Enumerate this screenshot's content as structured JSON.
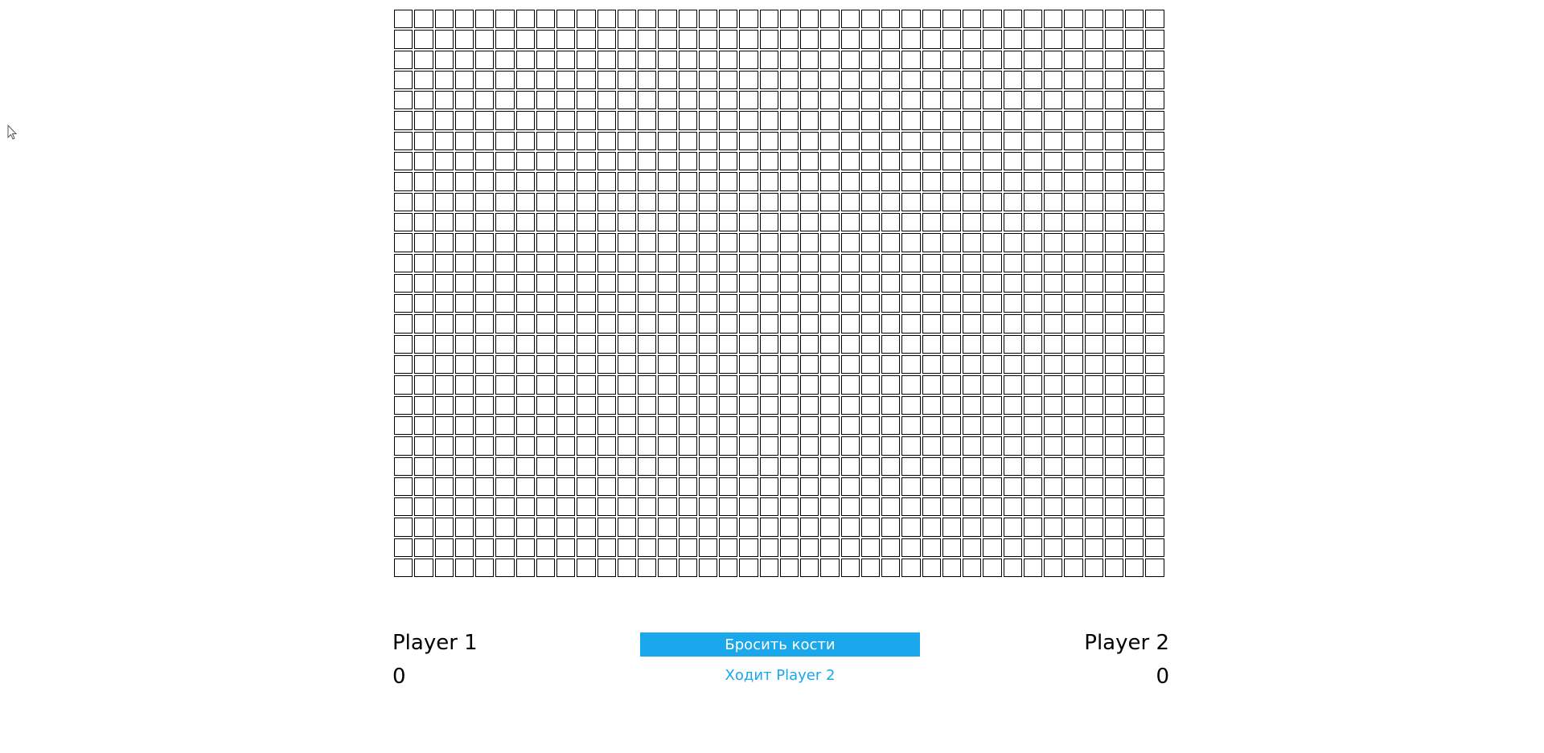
{
  "board": {
    "columns": 38,
    "rows": 28
  },
  "players": [
    {
      "name": "Player 1",
      "score": "0"
    },
    {
      "name": "Player 2",
      "score": "0"
    }
  ],
  "controls": {
    "roll_label": "Бросить кости",
    "turn_status": "Ходит Player 2"
  },
  "colors": {
    "accent": "#1aa7ec",
    "cell_border": "#000000",
    "background": "#ffffff"
  },
  "icons": {
    "cursor": "mouse-pointer-icon"
  }
}
